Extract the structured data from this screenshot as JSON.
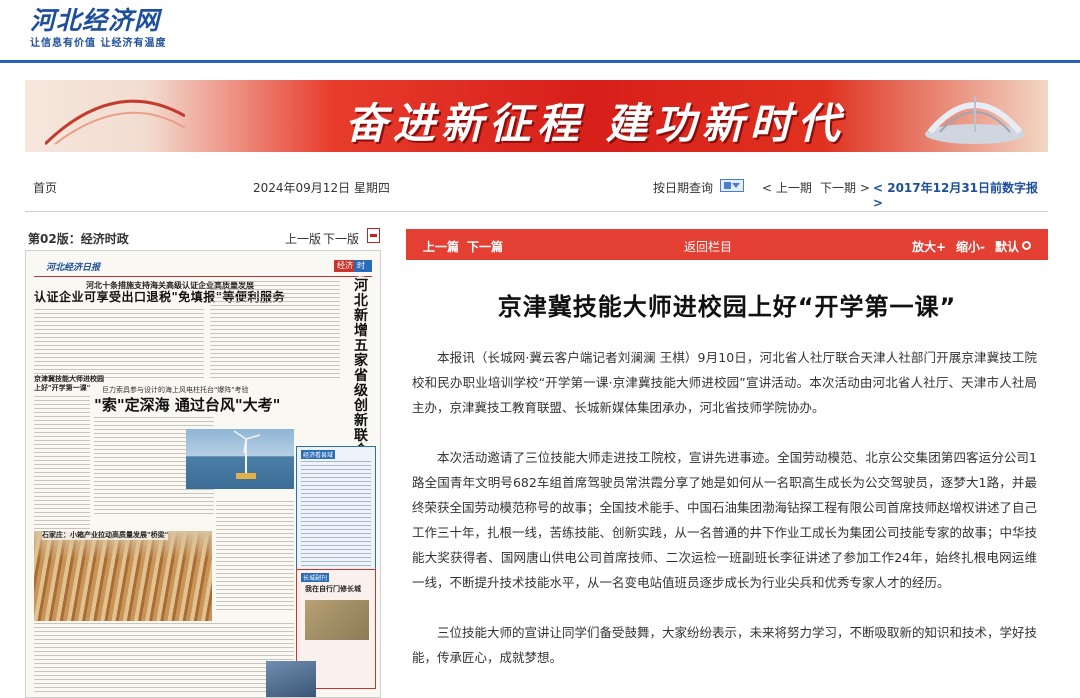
{
  "header": {
    "logo_title": "河北经济网",
    "logo_slogan": "让信息有价值 让经济有温度"
  },
  "banner": {
    "text": "奋进新征程 建功新时代"
  },
  "toolbar": {
    "home": "首页",
    "date": "2024年09月12日  星期四",
    "date_query": "按日期查询",
    "prev_issue": "< 上一期",
    "next_issue": "下一期 >",
    "archive_link": "< 2017年12月31日前数字报 >"
  },
  "edition": {
    "title": "第02版：经济时政",
    "prev_page": "上一版",
    "next_page": "下一版"
  },
  "newspaper": {
    "logo": "河北经济日报",
    "tag1": "经济",
    "tag2": "时政",
    "headline_small": "河北十条措施支持海关高级认证企业高质量发展",
    "headline": "认证企业可享受出口退税\"免填报\"等便利服务",
    "vertical": "河北新增五家省级创新联合体",
    "sub": "京津冀技能大师进校园上好\"开学第一课\"",
    "headline2_small": "巨力索具参与设计的海上风电柱托台\"爆阵\"考验",
    "headline2": "\"索\"定深海 通过台风\"大考\"",
    "blue_box_label": "经济看县域",
    "red_box_label": "长城副刊",
    "red_box_title": "我在自行门修长城",
    "photo_caption": "石家庄：小箱产业拉动高质量发展\"桥梁\""
  },
  "article_nav": {
    "prev": "上一篇",
    "next": "下一篇",
    "back": "返回栏目",
    "bigger": "放大+",
    "smaller": "缩小-",
    "default": "默认"
  },
  "article": {
    "title": "京津冀技能大师进校园上好“开学第一课”",
    "paragraphs": [
      "本报讯（长城网·冀云客户端记者刘澜澜 王棋）9月10日，河北省人社厅联合天津人社部门开展京津冀技工院校和民办职业培训学校“开学第一课·京津冀技能大师进校园”宣讲活动。本次活动由河北省人社厅、天津市人社局主办，京津冀技工教育联盟、长城新媒体集团承办，河北省技师学院协办。",
      "本次活动邀请了三位技能大师走进技工院校，宣讲先进事迹。全国劳动模范、北京公交集团第四客运分公司1路全国青年文明号682车组首席驾驶员常洪霞分享了她是如何从一名职高生成长为公交驾驶员，逐梦大1路，并最终荣获全国劳动模范称号的故事；全国技术能手、中国石油集团渤海钻探工程有限公司首席技师赵增权讲述了自己工作三十年，扎根一线，苦练技能、创新实践，从一名普通的井下作业工成长为集团公司技能专家的故事；中华技能大奖获得者、国网唐山供电公司首席技师、二次运检一班副班长李征讲述了参加工作24年，始终扎根电网运维一线，不断提升技术技能水平，从一名变电站值班员逐步成长为行业尖兵和优秀专家人才的经历。",
      "三位技能大师的宣讲让同学们备受鼓舞，大家纷纷表示，未来将努力学习，不断吸取新的知识和技术，学好技能，传承匠心，成就梦想。"
    ]
  },
  "colors": {
    "brand_blue": "#1d4f9c",
    "nav_red": "#e33f33"
  }
}
